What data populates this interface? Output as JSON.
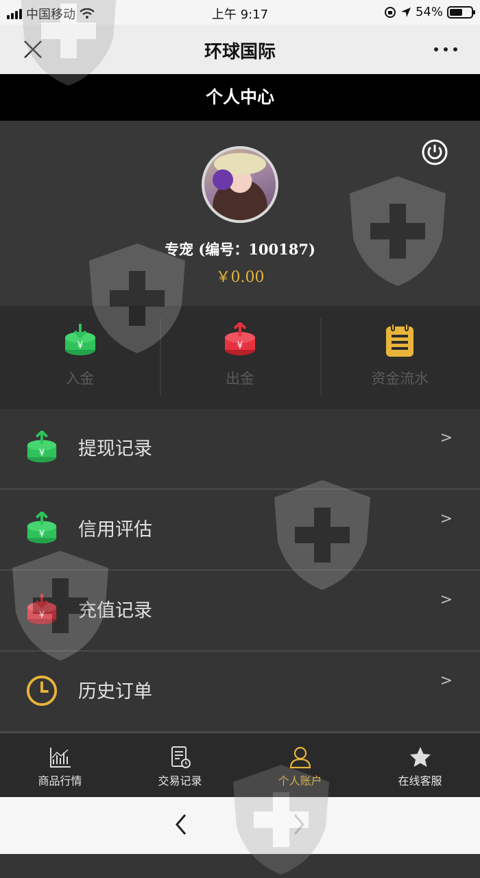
{
  "status_bar": {
    "carrier": "中国移动",
    "time": "上午 9:17",
    "battery": "54%"
  },
  "nav": {
    "title": "环球国际"
  },
  "page": {
    "title": "个人中心"
  },
  "profile": {
    "name": "专宠",
    "id_text": "(编号：100187)",
    "balance": "￥0.00"
  },
  "actions": [
    {
      "label": "入金",
      "icon": "deposit-icon",
      "color": "#2fc25b"
    },
    {
      "label": "出金",
      "icon": "withdraw-icon",
      "color": "#e5323e"
    },
    {
      "label": "资金流水",
      "icon": "notepad-icon",
      "color": "#e8b53a"
    }
  ],
  "menu": [
    {
      "label": "提现记录",
      "icon": "withdraw-record-icon",
      "chevron": ">"
    },
    {
      "label": "信用评估",
      "icon": "credit-icon",
      "chevron": ">"
    },
    {
      "label": "充值记录",
      "icon": "recharge-record-icon",
      "chevron": ">"
    },
    {
      "label": "历史订单",
      "icon": "clock-icon",
      "chevron": ">"
    }
  ],
  "tabs": [
    {
      "label": "商品行情",
      "icon": "chart-icon"
    },
    {
      "label": "交易记录",
      "icon": "document-icon"
    },
    {
      "label": "个人账户",
      "icon": "user-icon",
      "active": true
    },
    {
      "label": "在线客服",
      "icon": "star-icon"
    }
  ],
  "colors": {
    "accent": "#e8b53a",
    "green": "#2fc25b",
    "red": "#e5323e"
  }
}
